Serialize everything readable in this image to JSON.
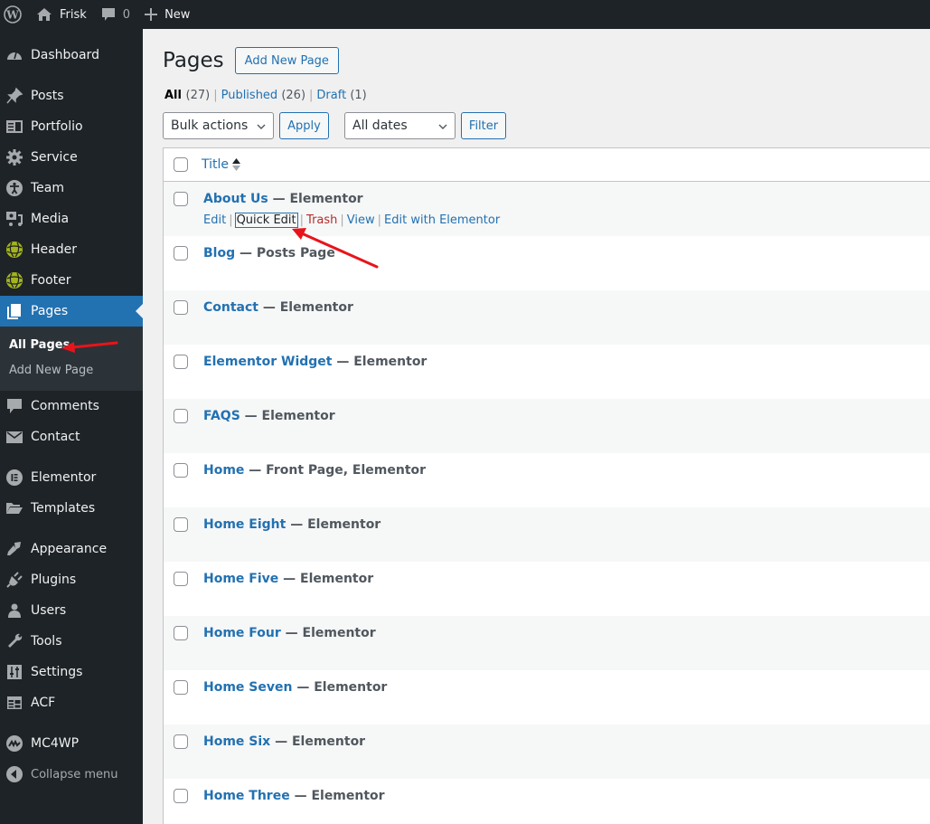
{
  "admin_bar": {
    "site_name": "Frisk",
    "comments_count": "0",
    "new_label": "New"
  },
  "sidebar": {
    "items": [
      {
        "label": "Dashboard",
        "icon": "dashboard-icon"
      },
      {
        "label": "Posts",
        "icon": "pin-icon"
      },
      {
        "label": "Portfolio",
        "icon": "portfolio-icon"
      },
      {
        "label": "Service",
        "icon": "gear-icon"
      },
      {
        "label": "Team",
        "icon": "accessibility-icon"
      },
      {
        "label": "Media",
        "icon": "media-icon"
      },
      {
        "label": "Header",
        "icon": "globe-icon"
      },
      {
        "label": "Footer",
        "icon": "globe-icon"
      },
      {
        "label": "Pages",
        "icon": "pages-icon",
        "current": true
      },
      {
        "label": "Comments",
        "icon": "comment-icon"
      },
      {
        "label": "Contact",
        "icon": "mail-icon"
      },
      {
        "label": "Elementor",
        "icon": "elementor-icon"
      },
      {
        "label": "Templates",
        "icon": "folder-icon"
      },
      {
        "label": "Appearance",
        "icon": "brush-icon"
      },
      {
        "label": "Plugins",
        "icon": "plug-icon"
      },
      {
        "label": "Users",
        "icon": "user-icon"
      },
      {
        "label": "Tools",
        "icon": "wrench-icon"
      },
      {
        "label": "Settings",
        "icon": "sliders-icon"
      },
      {
        "label": "ACF",
        "icon": "table-icon"
      },
      {
        "label": "MC4WP",
        "icon": "mc4wp-icon"
      }
    ],
    "submenu": [
      {
        "label": "All Pages",
        "current": true
      },
      {
        "label": "Add New Page"
      }
    ],
    "collapse_label": "Collapse menu"
  },
  "main": {
    "title": "Pages",
    "add_new_label": "Add New Page",
    "filters": [
      {
        "label": "All",
        "count": "(27)",
        "current": true
      },
      {
        "label": "Published",
        "count": "(26)"
      },
      {
        "label": "Draft",
        "count": "(1)"
      }
    ],
    "bulk_actions": "Bulk actions",
    "apply_label": "Apply",
    "dates_filter": "All dates",
    "filter_label": "Filter",
    "table": {
      "column_title": "Title",
      "row_actions": [
        "Edit",
        "Quick Edit",
        "Trash",
        "View",
        "Edit with Elementor"
      ],
      "rows": [
        {
          "title": "About Us",
          "state": " — Elementor"
        },
        {
          "title": "Blog",
          "state": " — Posts Page"
        },
        {
          "title": "Contact",
          "state": " — Elementor"
        },
        {
          "title": "Elementor Widget",
          "state": " — Elementor"
        },
        {
          "title": "FAQS",
          "state": " — Elementor"
        },
        {
          "title": "Home",
          "state": " — Front Page, Elementor"
        },
        {
          "title": "Home Eight",
          "state": " — Elementor"
        },
        {
          "title": "Home Five",
          "state": " — Elementor"
        },
        {
          "title": "Home Four",
          "state": " — Elementor"
        },
        {
          "title": "Home Seven",
          "state": " — Elementor"
        },
        {
          "title": "Home Six",
          "state": " — Elementor"
        },
        {
          "title": "Home Three",
          "state": " — Elementor"
        }
      ]
    }
  },
  "colors": {
    "admin_bar_bg": "#1d2327",
    "accent": "#2271b1",
    "trash": "#b32d2e",
    "annotation_arrow": "#e8141b"
  }
}
